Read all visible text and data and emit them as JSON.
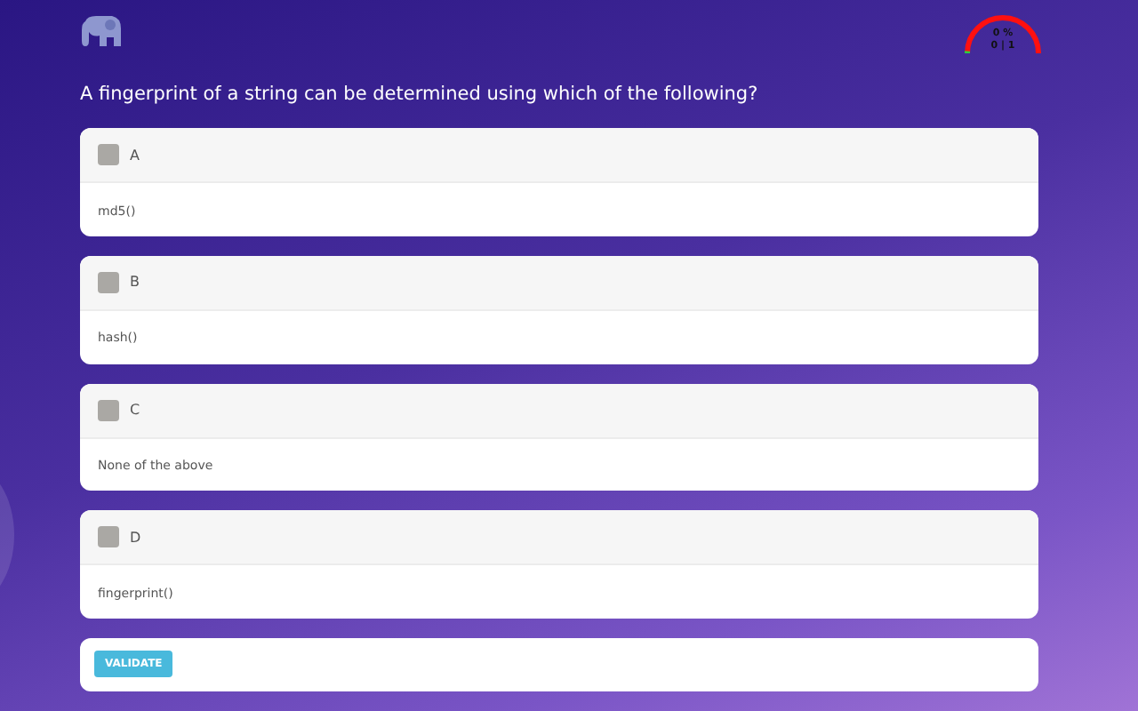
{
  "score": {
    "percent": "0 %",
    "count": "0 | 1"
  },
  "question": "A fingerprint of a string can be determined using which of the following?",
  "options": [
    {
      "letter": "A",
      "answer": "md5()",
      "checked": false
    },
    {
      "letter": "B",
      "answer": "hash()",
      "checked": false
    },
    {
      "letter": "C",
      "answer": "None of the above",
      "checked": false
    },
    {
      "letter": "D",
      "answer": "fingerprint()",
      "checked": false
    }
  ],
  "validate_button": "VALIDATE"
}
